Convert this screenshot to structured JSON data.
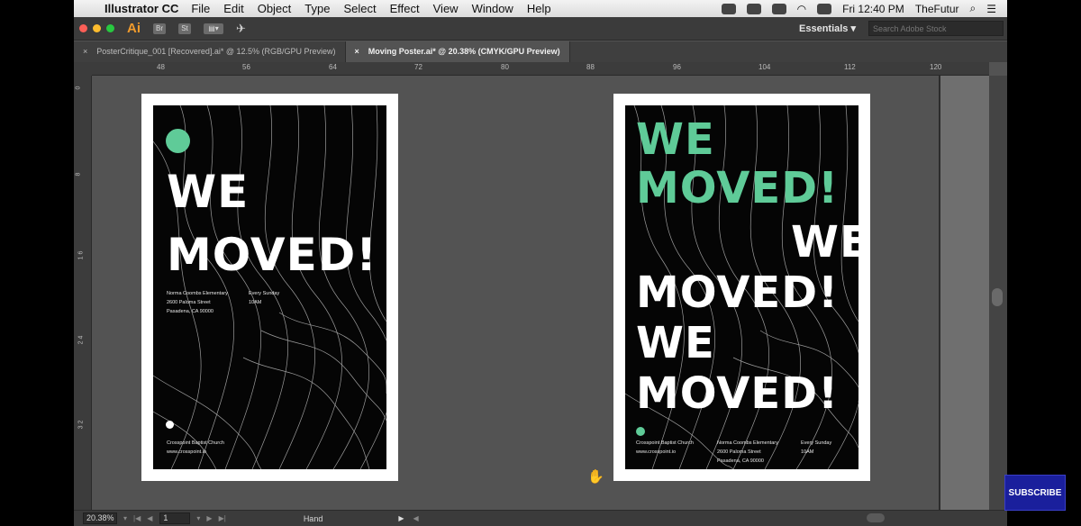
{
  "menubar": {
    "apple_glyph": "",
    "app_name": "Illustrator CC",
    "menus": [
      "File",
      "Edit",
      "Object",
      "Type",
      "Select",
      "Effect",
      "View",
      "Window",
      "Help"
    ],
    "clock": "Fri 12:40 PM",
    "user": "TheFutur"
  },
  "appbar": {
    "logo": "Ai",
    "bridge_label": "Br",
    "stock_label": "St",
    "workspace": "Essentials",
    "stock_search_placeholder": "Search Adobe Stock"
  },
  "tabs": [
    {
      "label": "PosterCritique_001 [Recovered].ai* @ 12.5% (RGB/GPU Preview)",
      "active": false
    },
    {
      "label": "Moving Poster.ai* @ 20.38% (CMYK/GPU Preview)",
      "active": true
    }
  ],
  "ruler": {
    "top_ticks": [
      "48",
      "56",
      "64",
      "72",
      "80",
      "88",
      "96",
      "104",
      "112",
      "120"
    ],
    "left_ticks": [
      "0",
      "8",
      "1\n6",
      "2\n4",
      "3\n2"
    ]
  },
  "status": {
    "zoom": "20.38%",
    "artboard": "1",
    "tool": "Hand"
  },
  "poster_left": {
    "headline_line1": "WE",
    "headline_line2": "MOVED!",
    "info_col1": [
      "Norma Coombs Elementary",
      "2600 Paloma Street",
      "Pasadena, CA 90000"
    ],
    "info_col2": [
      "Every Sunday",
      "10AM"
    ],
    "footer": [
      "Crosspoint Baptist Church",
      "www.crosspoint.io"
    ]
  },
  "poster_right": {
    "green_line1": "WE",
    "green_line2": "MOVED!",
    "white_offset": "WE",
    "white_line1": "MOVED!",
    "white_line2": "WE",
    "white_line3": "MOVED!",
    "footer_col1": [
      "Crosspoint Baptist Church",
      "www.crosspoint.io"
    ],
    "footer_col2": [
      "Norma Coombs Elementary",
      "2600 Paloma Street",
      "Pasadena, CA 90000"
    ],
    "footer_col3": [
      "Every Sunday",
      "10AM"
    ]
  },
  "colors": {
    "accent_green": "#5fcb98",
    "poster_black": "#050505",
    "subscribe_bg": "#1a1f9c"
  },
  "overlay": {
    "subscribe": "SUBSCRIBE"
  }
}
